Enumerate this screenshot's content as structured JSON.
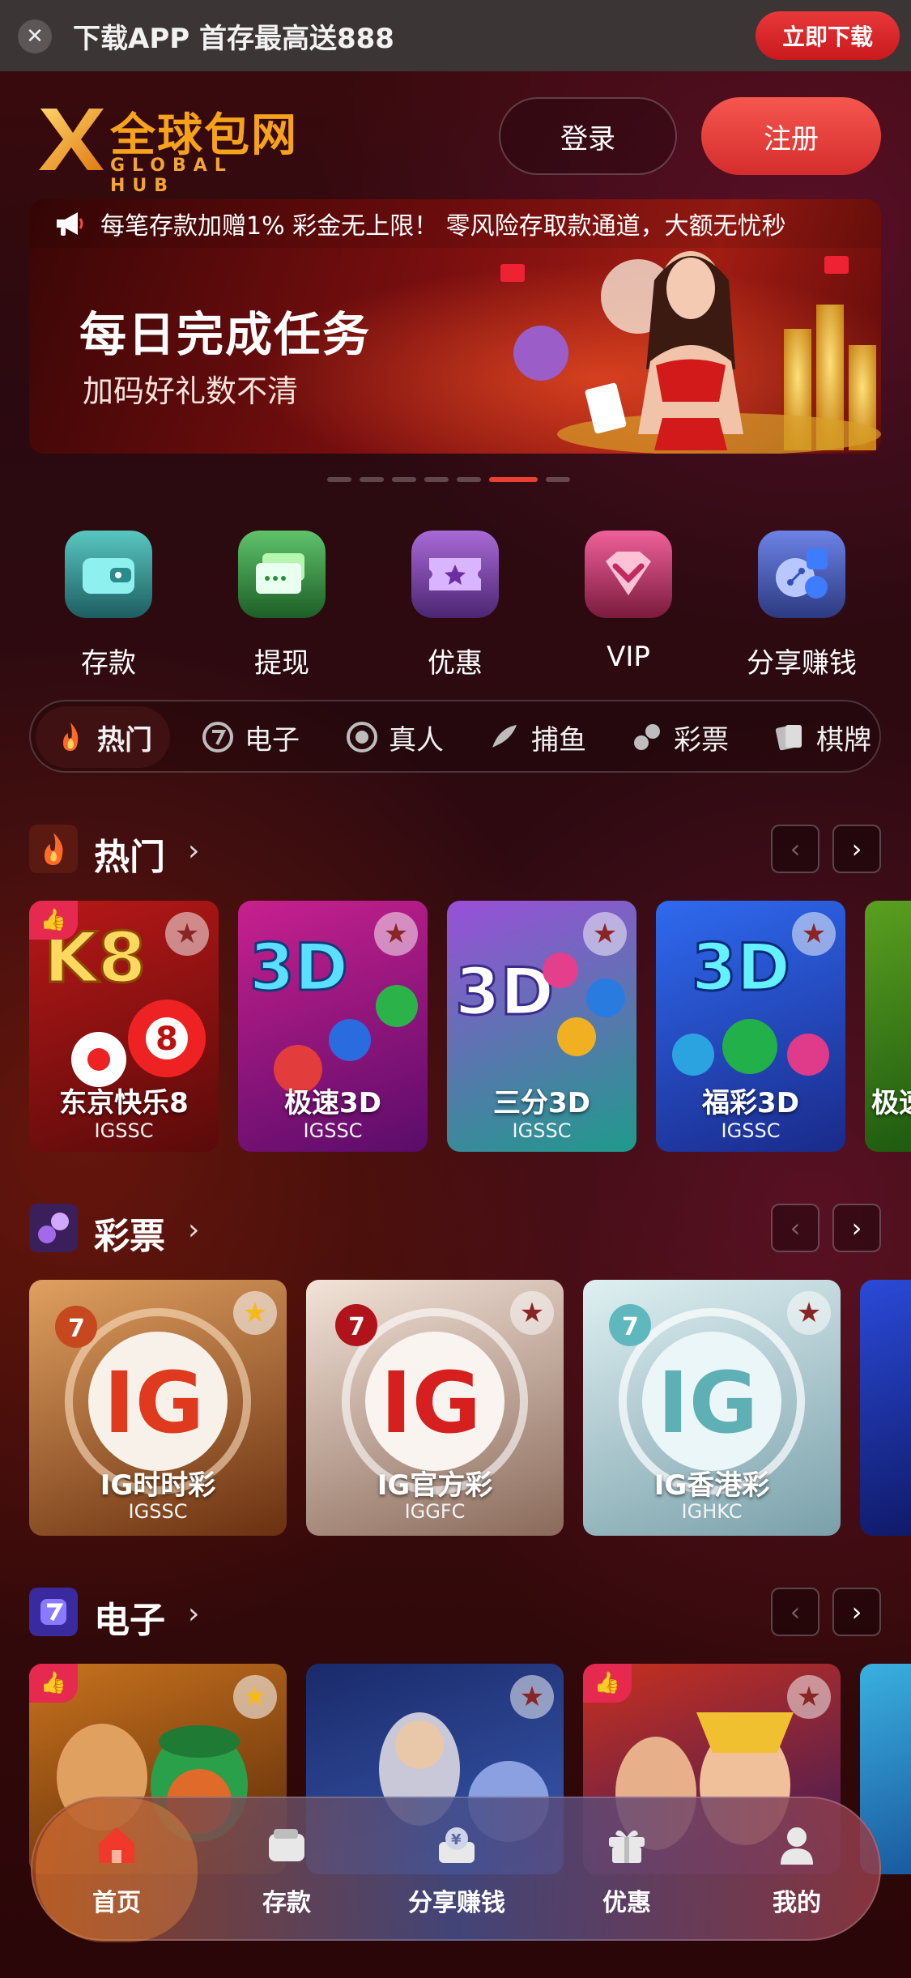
{
  "topbar": {
    "close_label": "✕",
    "promo_text": "下载APP 首存最高送888",
    "download_label": "立即下载"
  },
  "header": {
    "logo_cn": "全球包网",
    "logo_en": "GLOBAL HUB",
    "login_label": "登录",
    "register_label": "注册"
  },
  "banner": {
    "marquee": "每笔存款加赠1% 彩金无上限！ 零风险存取款通道，大额无忧秒",
    "title": "每日完成任务",
    "subtitle": "加码好礼数不清",
    "dots_total": 8,
    "active_dot": 6
  },
  "quick": [
    {
      "label": "存款",
      "icon": "wallet-icon"
    },
    {
      "label": "提现",
      "icon": "cash-icon"
    },
    {
      "label": "优惠",
      "icon": "ticket-star-icon"
    },
    {
      "label": "VIP",
      "icon": "diamond-icon"
    },
    {
      "label": "分享赚钱",
      "icon": "share-icon"
    }
  ],
  "tabs": [
    {
      "label": "热门",
      "icon": "flame-icon"
    },
    {
      "label": "电子",
      "icon": "slot-icon"
    },
    {
      "label": "真人",
      "icon": "chip-icon"
    },
    {
      "label": "捕鱼",
      "icon": "fish-icon"
    },
    {
      "label": "彩票",
      "icon": "lottery-icon"
    },
    {
      "label": "棋牌",
      "icon": "cards-icon"
    }
  ],
  "sections": {
    "hot": {
      "title": "热门",
      "cards": [
        {
          "name": "东京快乐8",
          "provider": "IGSSC",
          "art": "K8"
        },
        {
          "name": "极速3D",
          "provider": "IGSSC",
          "art": "3D"
        },
        {
          "name": "三分3D",
          "provider": "IGSSC",
          "art": "3D"
        },
        {
          "name": "福彩3D",
          "provider": "IGSSC",
          "art": "3D"
        },
        {
          "name": "极速",
          "provider": "",
          "art": ""
        }
      ]
    },
    "lottery": {
      "title": "彩票",
      "cards": [
        {
          "name": "IG时时彩",
          "provider": "IGSSC",
          "art": "IG"
        },
        {
          "name": "IG官方彩",
          "provider": "IGGFC",
          "art": "IG"
        },
        {
          "name": "IG香港彩",
          "provider": "IGHKC",
          "art": "IG"
        }
      ]
    },
    "slots": {
      "title": "电子"
    }
  },
  "bottomnav": [
    {
      "label": "首页",
      "icon": "home-icon"
    },
    {
      "label": "存款",
      "icon": "wallet-icon"
    },
    {
      "label": "分享赚钱",
      "icon": "share-money-icon"
    },
    {
      "label": "优惠",
      "icon": "gift-icon"
    },
    {
      "label": "我的",
      "icon": "user-icon"
    }
  ],
  "colors": {
    "accent_red": "#e8412f",
    "logo_gold": "#f7a21b",
    "register_red": "#f5574f"
  }
}
